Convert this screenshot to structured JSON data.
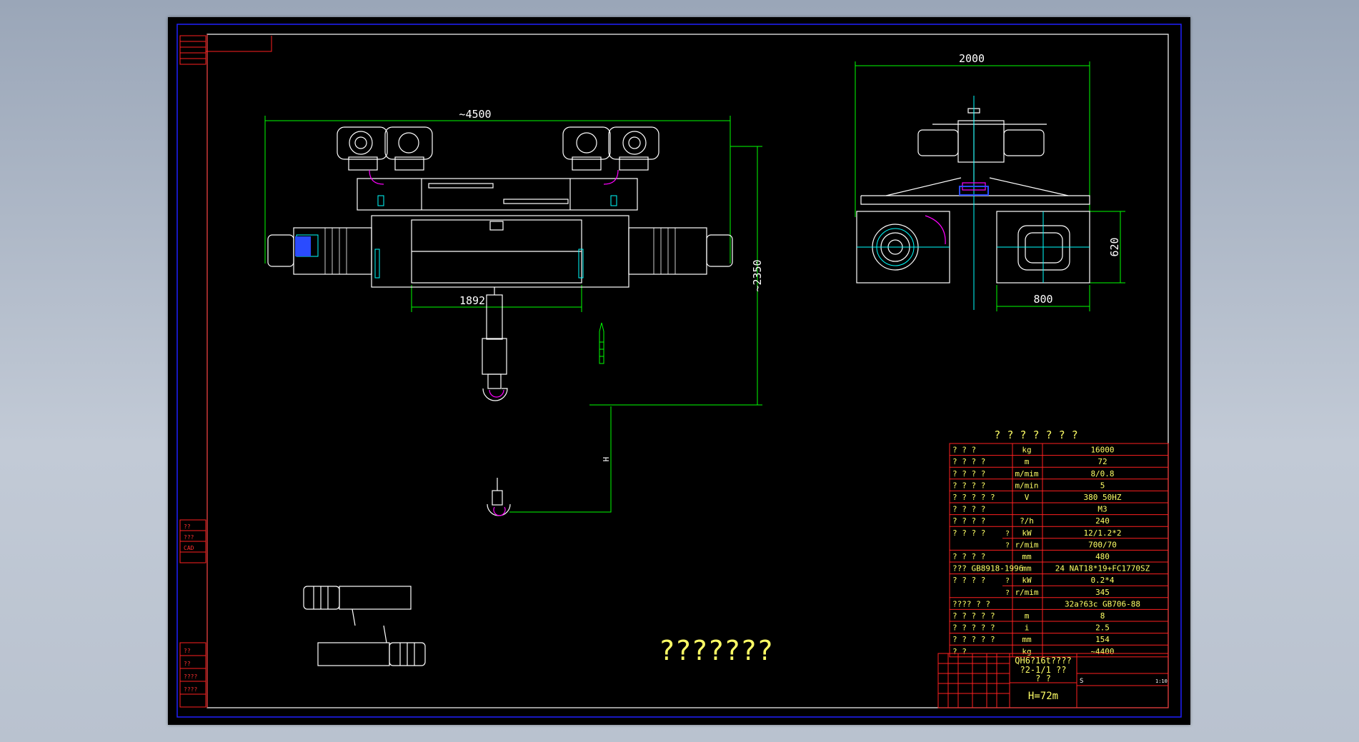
{
  "drawing": {
    "dimensions": {
      "overall_length": "~4500",
      "wheel_gauge": "1892",
      "height": "~2350",
      "side_width": "2000",
      "side_height": "620",
      "side_body_width": "800",
      "lift_label": "H"
    },
    "big_title": "???????",
    "spec_table": {
      "heading": "? ? ? ? ? ? ?",
      "rows": [
        {
          "name": "?    ?    ?",
          "unit": "kg",
          "value": "16000"
        },
        {
          "name": "? ? ? ?",
          "unit": "m",
          "value": "72"
        },
        {
          "name": "? ? ? ?",
          "unit": "m/mim",
          "value": "8/0.8"
        },
        {
          "name": "? ? ? ?",
          "unit": "m/min",
          "value": "5"
        },
        {
          "name": "? ? ? ?     ?",
          "unit": "V",
          "value": "380       50HZ"
        },
        {
          "name": "? ? ? ?",
          "unit": "",
          "value": "M3"
        },
        {
          "name": "? ? ? ?",
          "unit": "?/h",
          "value": "240"
        },
        {
          "name": "? ? ? ?",
          "sub": "?",
          "unit": "kW",
          "value": "12/1.2*2"
        },
        {
          "name": "",
          "sub": "?",
          "unit": "r/mim",
          "value": "700/70"
        },
        {
          "name": "? ? ? ?",
          "unit": "mm",
          "value": "480"
        },
        {
          "name": "???    GB8918-1996",
          "unit": "mm",
          "value": "24   NAT18*19+FC1770SZ"
        },
        {
          "name": "? ? ? ?",
          "sub": "?",
          "unit": "kW",
          "value": "0.2*4"
        },
        {
          "name": "",
          "sub": "?",
          "unit": "r/mim",
          "value": "345"
        },
        {
          "name": "????      ?         ?",
          "unit": "",
          "value": "32a?63c          GB706-88"
        },
        {
          "name": "      ? ? ? ? ?",
          "unit": "m",
          "value": "8"
        },
        {
          "name": "? ? ? ? ?",
          "unit": "i",
          "value": "2.5"
        },
        {
          "name": "? ? ? ? ?",
          "unit": "mm",
          "value": "154"
        },
        {
          "name": "?             ?",
          "unit": "kg",
          "value": "~4400"
        }
      ]
    },
    "title_block": {
      "model_line1": "QH6?16t????",
      "model_line2": "?2-1/1 ??",
      "model_line3": "?      ?",
      "height_label": "H=72m",
      "scale_mark": "S",
      "sheet_mark": "1:10"
    },
    "side_labels": [
      "??",
      "???",
      "CAD",
      "??",
      "??",
      "????",
      "????"
    ],
    "colors": {
      "background": "#000000",
      "frame_blue": "#2020ff",
      "frame_white": "#ffffff",
      "dimension_green": "#00ff00",
      "table_red": "#ff2020",
      "text_yellow": "#ffff66",
      "part_cyan": "#00ffff",
      "part_magenta": "#ff00ff"
    }
  }
}
